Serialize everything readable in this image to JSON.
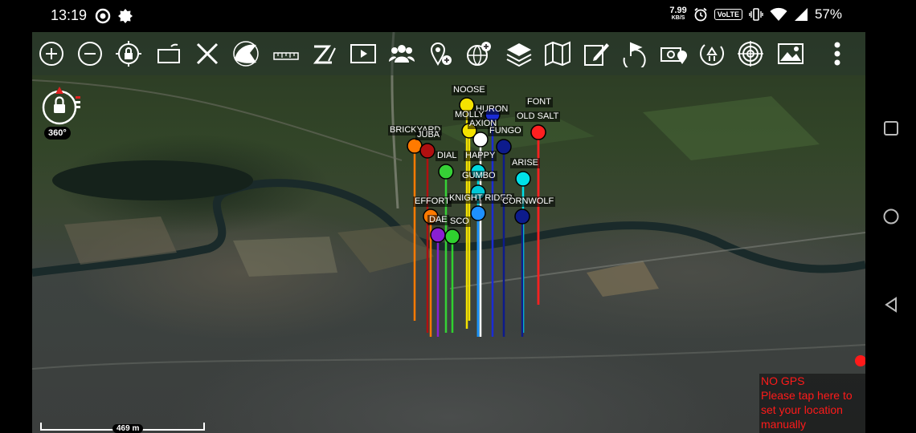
{
  "status_bar": {
    "time": "13:19",
    "net_speed_value": "7.99",
    "net_speed_unit": "KB/S",
    "volte": "VoLTE",
    "battery": "57%"
  },
  "toolbar": {
    "icons": [
      "zoom-in-icon",
      "zoom-out-icon",
      "lock-location-icon",
      "rotate-screen-icon",
      "close-x-icon",
      "speaker-broadcast-icon",
      "ruler-icon",
      "distance-tool-icon",
      "video-player-icon",
      "contacts-group-icon",
      "add-map-point-icon",
      "add-globe-overlay-icon",
      "layers-icon",
      "map-icon",
      "draw-edit-icon",
      "route-flag-icon",
      "camera-geotag-icon",
      "recycle-refresh-icon",
      "target-crosshair-icon",
      "image-gallery-icon",
      "overflow-menu-icon"
    ]
  },
  "compass": {
    "mode_label": "360°"
  },
  "markers": [
    {
      "name": "NOOSE",
      "color": "#f4e200"
    },
    {
      "name": "HURON",
      "color": "#1a2bd6"
    },
    {
      "name": "FONT",
      "color": "#ff2020"
    },
    {
      "name": "MOLLY",
      "color": "#f4e200"
    },
    {
      "name": "OLD SALT",
      "color": "#ff2020"
    },
    {
      "name": "AXION",
      "color": "#ffffff"
    },
    {
      "name": "BRICKYARD",
      "color": "#ff7a00"
    },
    {
      "name": "JUBA",
      "color": "#b01010"
    },
    {
      "name": "FUNGO",
      "color": "#0d1b8c"
    },
    {
      "name": "DIAL",
      "color": "#36d136"
    },
    {
      "name": "HAPPY",
      "color": "#00d8e0"
    },
    {
      "name": "ARISE",
      "color": "#00e0e8"
    },
    {
      "name": "GUMBO",
      "color": "#00c8d8"
    },
    {
      "name": "EFFORT",
      "color": "#ff7a00"
    },
    {
      "name": "KNIGHT RIDER",
      "color": "#1e90ff"
    },
    {
      "name": "CORNWOLF",
      "color": "#0d1b8c"
    },
    {
      "name": "DAE",
      "color": "#8a1fd0"
    },
    {
      "name": "SCO",
      "color": "#2fd12f"
    }
  ],
  "scale": {
    "label": "469 m"
  },
  "nogps": {
    "line1": "NO GPS",
    "line2": "Please tap here to",
    "line3": "set your location",
    "line4": "manually"
  },
  "nav": {
    "icons": [
      "recents-square-icon",
      "home-circle-icon",
      "back-triangle-icon"
    ]
  }
}
